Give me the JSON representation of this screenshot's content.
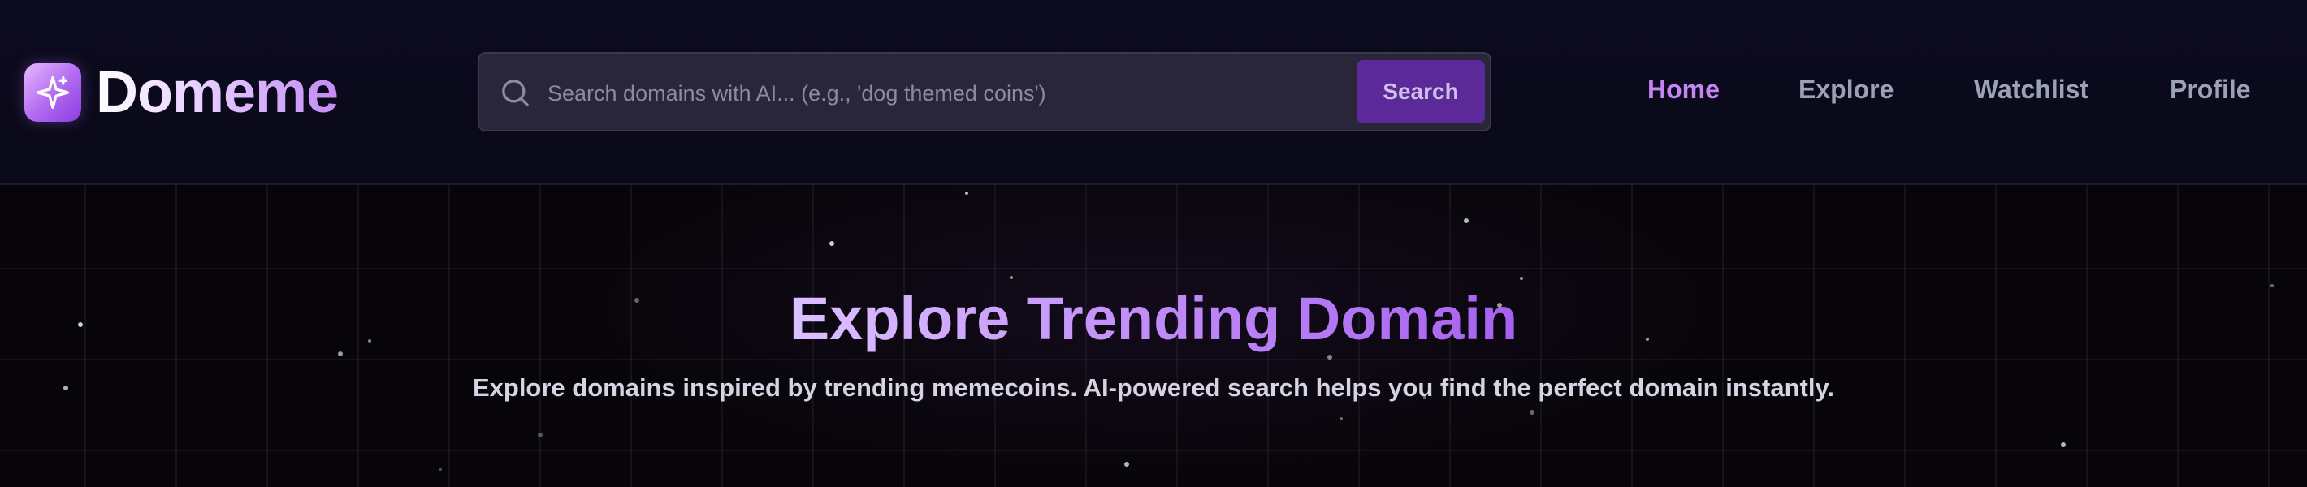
{
  "brand": {
    "name": "Domeme",
    "icon": "sparkle-icon"
  },
  "search": {
    "placeholder": "Search domains with AI... (e.g., 'dog themed coins')",
    "value": "",
    "button_label": "Search",
    "icon": "search-icon"
  },
  "nav": {
    "items": [
      {
        "label": "Home",
        "active": true
      },
      {
        "label": "Explore",
        "active": false
      },
      {
        "label": "Watchlist",
        "active": false
      },
      {
        "label": "Profile",
        "active": false
      }
    ]
  },
  "hero": {
    "title": "Explore Trending Domain",
    "subtitle": "Explore domains inspired by trending memecoins. AI-powered search helps you find the perfect domain instantly."
  },
  "colors": {
    "accent": "#c485f5",
    "button": "#5b2a98",
    "header_bg": "#0c0b1e",
    "page_bg": "#050409"
  }
}
